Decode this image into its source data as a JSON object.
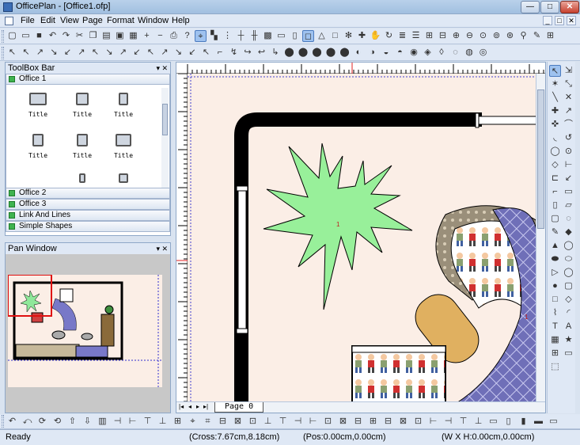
{
  "window": {
    "title": "OfficePlan - [Office1.ofp]",
    "controls": {
      "min": "—",
      "max": "□",
      "close": "✕"
    }
  },
  "menu": {
    "items": [
      "File",
      "Edit",
      "View",
      "Page",
      "Format",
      "Window",
      "Help"
    ],
    "mdi_controls": [
      "_",
      "□",
      "✕"
    ]
  },
  "toolbar1": {
    "tools": [
      {
        "icon": "new-icon",
        "glyph": "▢"
      },
      {
        "icon": "open-icon",
        "glyph": "▭"
      },
      {
        "icon": "save-icon",
        "glyph": "■"
      },
      {
        "icon": "undo-icon",
        "glyph": "↶"
      },
      {
        "icon": "redo-icon",
        "glyph": "↷"
      },
      {
        "icon": "cut-icon",
        "glyph": "✂"
      },
      {
        "icon": "copy-icon",
        "glyph": "❐"
      },
      {
        "icon": "paste-icon",
        "glyph": "▤"
      },
      {
        "icon": "page-view-icon",
        "glyph": "▣"
      },
      {
        "icon": "grid-icon",
        "glyph": "▦"
      },
      {
        "icon": "zoom-in-plus-icon",
        "glyph": "+"
      },
      {
        "icon": "zoom-out-minus-icon",
        "glyph": "−"
      },
      {
        "icon": "print-icon",
        "glyph": "⎙"
      },
      {
        "icon": "help-icon",
        "glyph": "?"
      },
      {
        "icon": "snap-icon",
        "glyph": "⌖"
      },
      {
        "icon": "select-mode-icon",
        "glyph": "▚"
      },
      {
        "icon": "grid-dots-icon",
        "glyph": "⋮"
      },
      {
        "icon": "connect-icon",
        "glyph": "┼"
      },
      {
        "icon": "align-icon",
        "glyph": "╫"
      },
      {
        "icon": "group-icon",
        "glyph": "▩"
      },
      {
        "icon": "frame-icon",
        "glyph": "▭"
      },
      {
        "icon": "text-frame-icon",
        "glyph": "▯"
      },
      {
        "icon": "rect-select-icon",
        "glyph": "◻"
      },
      {
        "icon": "triangle-icon",
        "glyph": "△"
      },
      {
        "icon": "square-icon",
        "glyph": "□"
      },
      {
        "icon": "gear-icon",
        "glyph": "✻"
      },
      {
        "icon": "cross-icon",
        "glyph": "✚"
      },
      {
        "icon": "hand-icon",
        "glyph": "✋"
      },
      {
        "icon": "rotate-icon",
        "glyph": "↻"
      },
      {
        "icon": "layers-icon",
        "glyph": "≣"
      },
      {
        "icon": "stack-icon",
        "glyph": "☰"
      },
      {
        "icon": "grid-select-icon",
        "glyph": "⊞"
      },
      {
        "icon": "tile-icon",
        "glyph": "⊟"
      },
      {
        "icon": "zoom-in-icon",
        "glyph": "⊕"
      },
      {
        "icon": "zoom-out-icon",
        "glyph": "⊖"
      },
      {
        "icon": "zoom-fit-icon",
        "glyph": "⊙"
      },
      {
        "icon": "zoom-page-icon",
        "glyph": "⊚"
      },
      {
        "icon": "zoom-width-icon",
        "glyph": "⊛"
      },
      {
        "icon": "magnify-icon",
        "glyph": "⚲"
      },
      {
        "icon": "pencil-icon",
        "glyph": "✎"
      },
      {
        "icon": "grid-4-icon",
        "glyph": "⊞"
      }
    ]
  },
  "toolbar2": {
    "tools": [
      "↖",
      "↖",
      "↗",
      "↘",
      "↙",
      "↗",
      "↖",
      "↘",
      "↗",
      "↙",
      "↖",
      "↗",
      "↘",
      "↙",
      "↖",
      "⌐",
      "↯",
      "↪",
      "↩",
      "↳",
      "⬤",
      "⬤",
      "⬤",
      "⬤",
      "⬤",
      "◐",
      "◑",
      "◒",
      "◓",
      "◉",
      "◈",
      "◊",
      "◌",
      "◍",
      "◎"
    ]
  },
  "toolbox": {
    "title": "ToolBox Bar",
    "controls": "▾ ✕",
    "active_group": "Office 1",
    "shapes": [
      "Title",
      "Title",
      "Title",
      "Title",
      "Title",
      "Title"
    ],
    "groups": [
      "Office 2",
      "Office 3",
      "Link And Lines",
      "Simple Shapes"
    ]
  },
  "panwindow": {
    "title": "Pan Window",
    "controls": "▾ ✕"
  },
  "canvas": {
    "page_tab": "Page  0",
    "nav": [
      "|◂",
      "◂",
      "▸",
      "▸|"
    ]
  },
  "right_tools": {
    "tools": [
      "↖",
      "⇲",
      "✶",
      "⤡",
      "╲",
      "✕",
      "✚",
      "↗",
      "✜",
      "⌒",
      "◟",
      "↺",
      "◯",
      "⊙",
      "◇",
      "⊢",
      "⊏",
      "↙",
      "⌐",
      "▭",
      "▯",
      "▱",
      "▢",
      "◌",
      "✎",
      "◆",
      "▲",
      "◯",
      "⬬",
      "⬭",
      "▷",
      "◯",
      "●",
      "▢",
      "□",
      "◇",
      "⌇",
      "◜",
      "T",
      "A",
      "▦",
      "★",
      "⊞",
      "▭",
      "⬚"
    ]
  },
  "bottom_toolbar": {
    "tools": [
      "↶",
      "⤺",
      "⟳",
      "⟲",
      "⇧",
      "⇩",
      "▥",
      "⊣",
      "⊢",
      "⊤",
      "⊥",
      "⊞",
      "⌖",
      "⌗",
      "⊟",
      "⊠",
      "⊡",
      "⊥",
      "⊤",
      "⊣",
      "⊢",
      "⊡",
      "⊠",
      "⊟",
      "⊞",
      "⊟",
      "⊠",
      "⊡",
      "⊢",
      "⊣",
      "⊤",
      "⊥",
      "▭",
      "▯",
      "▮",
      "▬",
      "▭"
    ]
  },
  "statusbar": {
    "ready": "Ready",
    "cross": "(Cross:7.67cm,8.18cm)",
    "pos": "(Pos:0.00cm,0.00cm)",
    "size": "(W X H:0.00cm,0.00cm)"
  }
}
